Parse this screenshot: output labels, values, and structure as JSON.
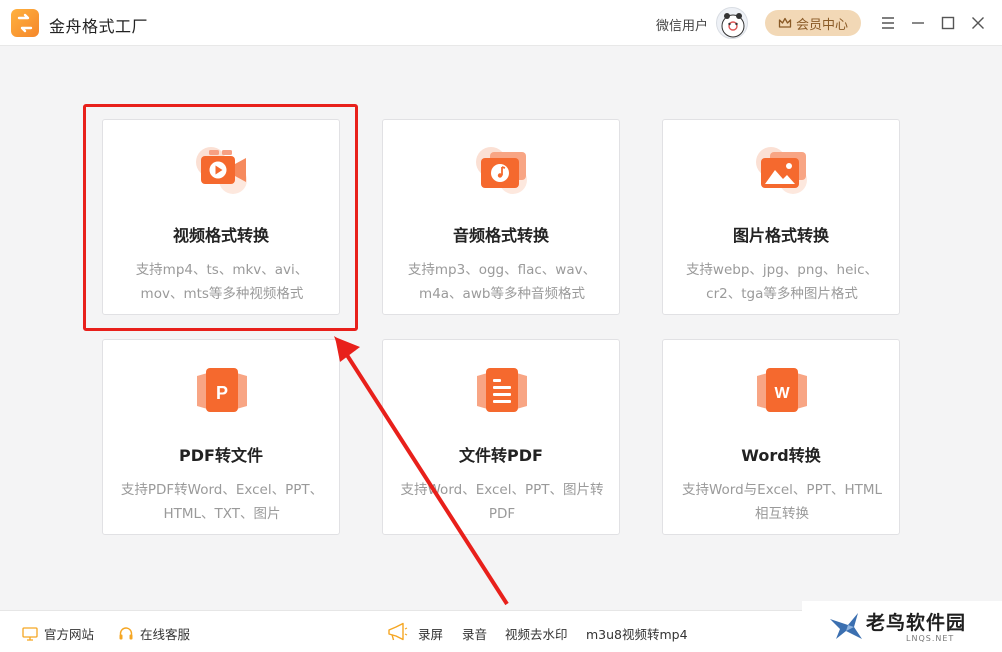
{
  "app": {
    "title": "金舟格式工厂"
  },
  "header": {
    "user_name": "微信用户",
    "vip_label": "会员中心"
  },
  "cards": [
    {
      "title": "视频格式转换",
      "desc": "支持mp4、ts、mkv、avi、mov、mts等多种视频格式",
      "icon": "video-icon"
    },
    {
      "title": "音频格式转换",
      "desc": "支持mp3、ogg、flac、wav、m4a、awb等多种音频格式",
      "icon": "audio-icon"
    },
    {
      "title": "图片格式转换",
      "desc": "支持webp、jpg、png、heic、cr2、tga等多种图片格式",
      "icon": "image-icon"
    },
    {
      "title": "PDF转文件",
      "desc": "支持PDF转Word、Excel、PPT、HTML、TXT、图片",
      "icon": "pdf-icon"
    },
    {
      "title": "文件转PDF",
      "desc": "支持Word、Excel、PPT、图片转PDF",
      "icon": "document-icon"
    },
    {
      "title": "Word转换",
      "desc": "支持Word与Excel、PPT、HTML相互转换",
      "icon": "word-icon"
    }
  ],
  "footer": {
    "website": "官方网站",
    "support": "在线客服",
    "record_screen": "录屏",
    "record_audio": "录音",
    "remove_watermark": "视频去水印",
    "m3u8": "m3u8视频转mp4"
  },
  "watermark": {
    "text": "老鸟软件园",
    "sub": "LNQS.NET"
  },
  "colors": {
    "accent": "#f5692e",
    "highlight": "#e8201b",
    "vip_bg": "#f2d8b6"
  }
}
